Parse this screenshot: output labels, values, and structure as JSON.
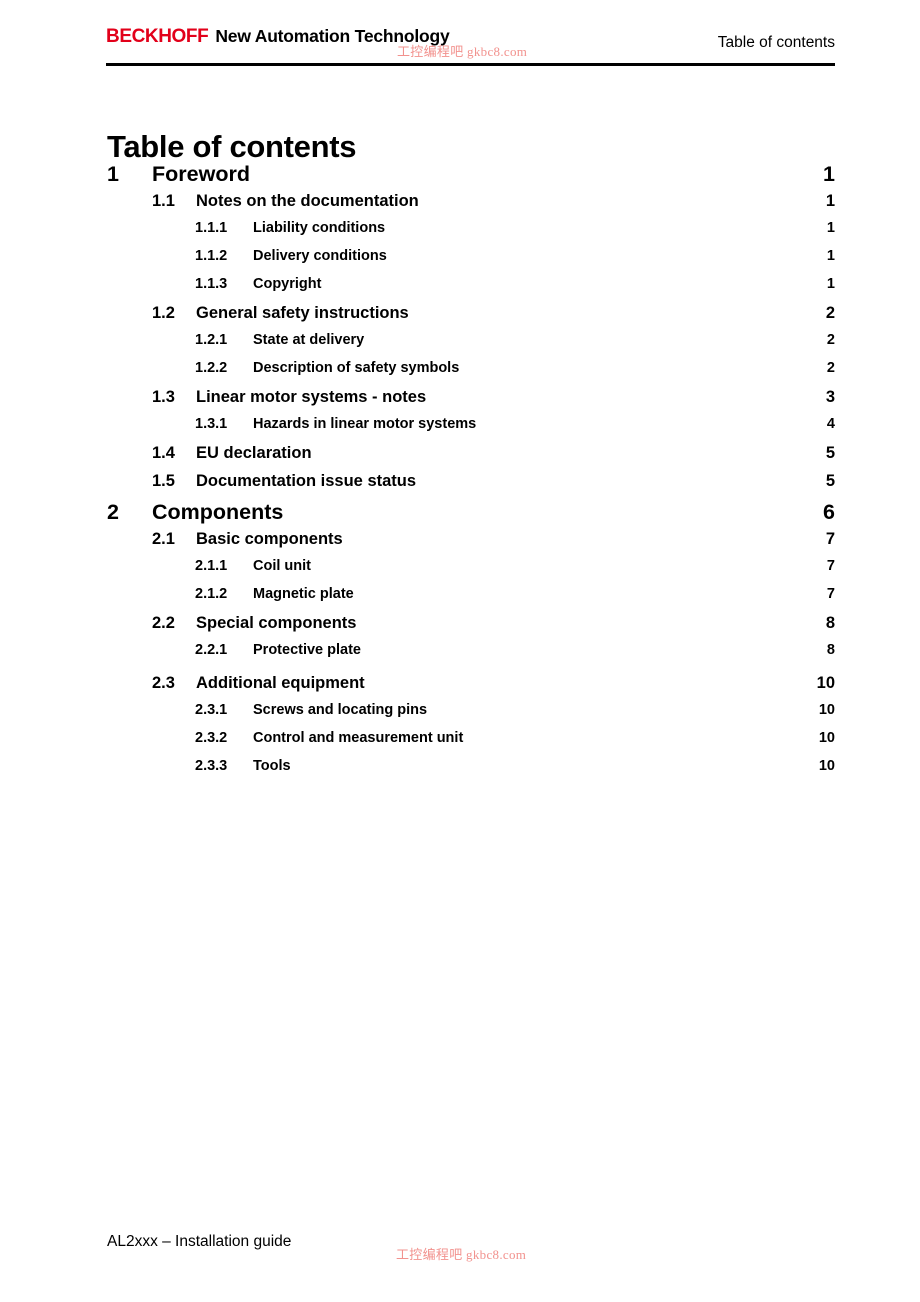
{
  "header": {
    "brand_name": "BECKHOFF",
    "brand_tagline": "New Automation Technology",
    "watermark": "工控编程吧  gkbc8.com",
    "right_title": "Table of contents"
  },
  "title": "Table of contents",
  "toc": {
    "entries": [
      {
        "level": 1,
        "number": "1",
        "label": "Foreword",
        "page": "1",
        "gap": false
      },
      {
        "level": 2,
        "number": "1.1",
        "label": "Notes on the documentation",
        "page": "1",
        "gap": false
      },
      {
        "level": 3,
        "number": "1.1.1",
        "label": "Liability conditions",
        "page": "1",
        "gap": false
      },
      {
        "level": 3,
        "number": "1.1.2",
        "label": "Delivery conditions",
        "page": "1",
        "gap": false
      },
      {
        "level": 3,
        "number": "1.1.3",
        "label": "Copyright",
        "page": "1",
        "gap": false
      },
      {
        "level": 2,
        "number": "1.2",
        "label": "General safety instructions",
        "page": "2",
        "gap": false
      },
      {
        "level": 3,
        "number": "1.2.1",
        "label": "State at delivery",
        "page": "2",
        "gap": false
      },
      {
        "level": 3,
        "number": "1.2.2",
        "label": "Description of safety symbols",
        "page": "2",
        "gap": false
      },
      {
        "level": 2,
        "number": "1.3",
        "label": "Linear motor systems - notes",
        "page": "3",
        "gap": false
      },
      {
        "level": 3,
        "number": "1.3.1",
        "label": "Hazards in linear motor systems",
        "page": "4",
        "gap": false
      },
      {
        "level": 2,
        "number": "1.4",
        "label": "EU declaration",
        "page": "5",
        "gap": false
      },
      {
        "level": 2,
        "number": "1.5",
        "label": "Documentation issue status",
        "page": "5",
        "gap": false
      },
      {
        "level": 1,
        "number": "2",
        "label": "Components",
        "page": "6",
        "gap": false
      },
      {
        "level": 2,
        "number": "2.1",
        "label": "Basic components",
        "page": "7",
        "gap": false
      },
      {
        "level": 3,
        "number": "2.1.1",
        "label": "Coil unit",
        "page": "7",
        "gap": false
      },
      {
        "level": 3,
        "number": "2.1.2",
        "label": "Magnetic plate",
        "page": "7",
        "gap": false
      },
      {
        "level": 2,
        "number": "2.2",
        "label": "Special components",
        "page": "8",
        "gap": false
      },
      {
        "level": 3,
        "number": "2.2.1",
        "label": "Protective plate",
        "page": "8",
        "gap": false
      },
      {
        "level": 2,
        "number": "2.3",
        "label": "Additional equipment",
        "page": "10",
        "gap": true
      },
      {
        "level": 3,
        "number": "2.3.1",
        "label": "Screws and locating pins",
        "page": "10",
        "gap": false
      },
      {
        "level": 3,
        "number": "2.3.2",
        "label": "Control and measurement unit",
        "page": "10",
        "gap": false
      },
      {
        "level": 3,
        "number": "2.3.3",
        "label": "Tools",
        "page": "10",
        "gap": false
      }
    ]
  },
  "footer": {
    "document_name": "AL2xxx – Installation guide",
    "watermark": "工控编程吧  gkbc8.com"
  },
  "colors": {
    "brand_red": "#e2001a",
    "watermark_pink": "#f2928e",
    "text_black": "#000000",
    "page_background": "#ffffff"
  }
}
